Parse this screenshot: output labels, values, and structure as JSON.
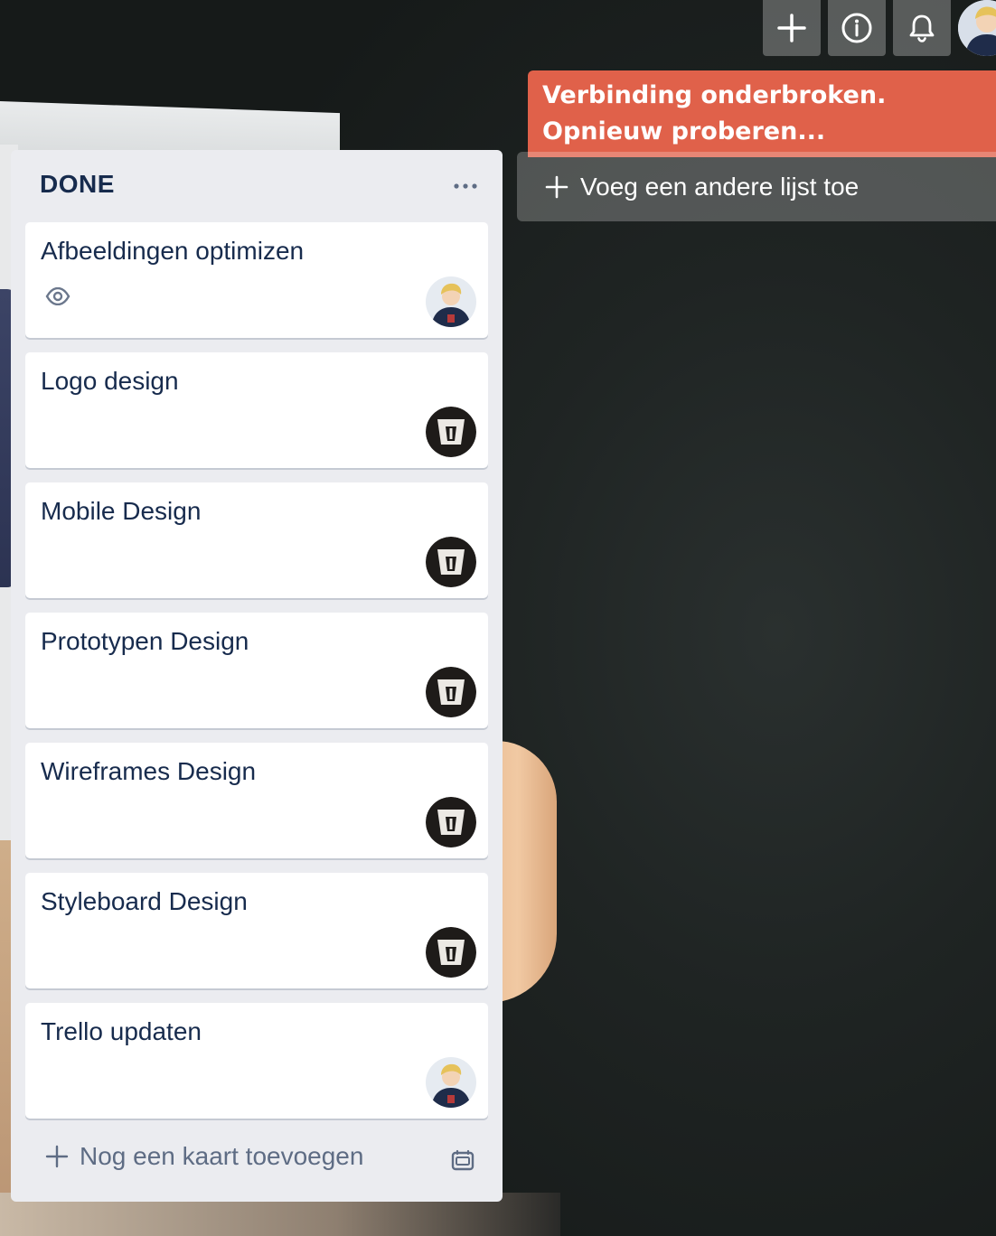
{
  "header": {
    "buttons": [
      {
        "name": "add-icon"
      },
      {
        "name": "info-icon"
      },
      {
        "name": "bell-icon"
      }
    ],
    "avatar": "member-avatar"
  },
  "banner": {
    "text": "Verbinding onderbroken. Opnieuw proberen..."
  },
  "add_list": {
    "label": "Voeg een andere lijst toe"
  },
  "list": {
    "title": "DONE",
    "cards": [
      {
        "title": "Afbeeldingen optimizen",
        "watching": true,
        "member": "photo-avatar"
      },
      {
        "title": "Logo design",
        "member": "logo-avatar"
      },
      {
        "title": "Mobile Design",
        "member": "logo-avatar"
      },
      {
        "title": "Prototypen Design",
        "member": "logo-avatar"
      },
      {
        "title": "Wireframes Design",
        "member": "logo-avatar"
      },
      {
        "title": "Styleboard Design",
        "member": "logo-avatar"
      },
      {
        "title": "Trello updaten",
        "member": "photo-avatar"
      }
    ],
    "add_card_label": "Nog een kaart toevoegen"
  },
  "colors": {
    "banner": "#e0614a",
    "list_bg": "#ebecf0",
    "card_text": "#172b4d",
    "muted_text": "#5e6c84"
  }
}
